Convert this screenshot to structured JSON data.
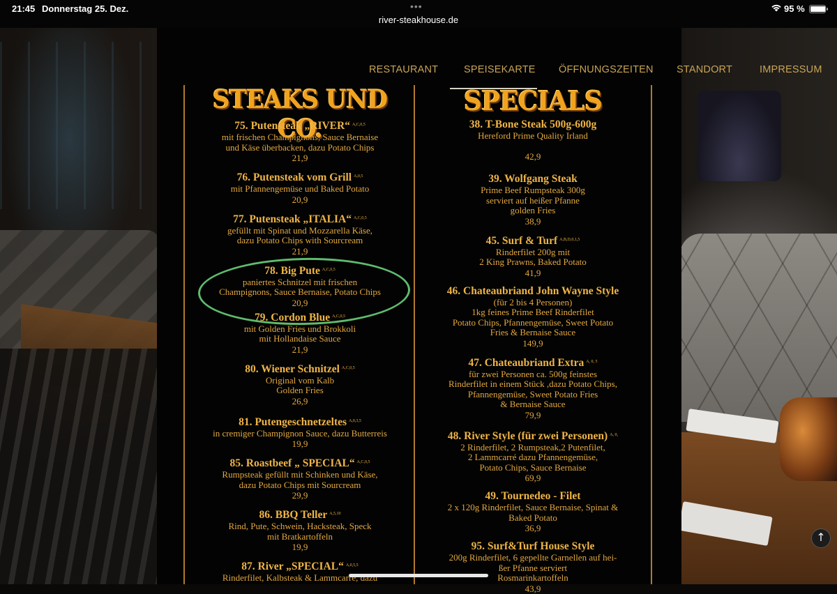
{
  "status_bar": {
    "time": "21:45",
    "date": "Donnerstag 25. Dez.",
    "url": "river-steakhouse.de",
    "battery_percent": "95 %",
    "battery_level": 0.95,
    "multitask_dots": "•••"
  },
  "nav": {
    "items": [
      {
        "label": "RESTAURANT",
        "active": false
      },
      {
        "label": "SPEISEKARTE",
        "active": true
      },
      {
        "label": "ÖFFNUNGSZEITEN",
        "active": false
      },
      {
        "label": "STANDORT",
        "active": false
      },
      {
        "label": "IMPRESSUM",
        "active": false
      }
    ]
  },
  "menu": {
    "left": {
      "heading": "Steaks und Co.",
      "entries": [
        {
          "title": "75. Putensteak „RIVER“",
          "codes": "A,C,0,5",
          "lines": [
            "mit frischen Champignons, Sauce Bernaise",
            "und Käse überbacken, dazu Potato Chips"
          ],
          "price": "21,9"
        },
        {
          "title": "76. Putensteak vom Grill",
          "codes": "A,0,5",
          "lines": [
            "mit Pfannengemüse und Baked Potato"
          ],
          "price": "20,9"
        },
        {
          "title": "77. Putensteak „ITALIA“",
          "codes": "A,C,0,5",
          "lines": [
            "gefüllt mit Spinat und Mozzarella Käse,",
            "dazu Potato Chips with Sourcream"
          ],
          "price": "21,9"
        },
        {
          "title": "78. Big Pute",
          "codes": "A,C,0,5",
          "lines": [
            "paniertes Schnitzel mit frischen",
            "Champignons, Sauce Bernaise, Potato Chips"
          ],
          "price": "20,9"
        },
        {
          "title": "79. Cordon Blue",
          "codes": "A,C,0,5",
          "lines": [
            "mit Golden Fries und Brokkoli",
            "mit Hollandaise Sauce"
          ],
          "price": "21,9"
        },
        {
          "title": "80. Wiener Schnitzel",
          "codes": "A,C,0,5",
          "lines": [
            "Original vom Kalb",
            "Golden Fries"
          ],
          "price": "26,9"
        },
        {
          "title": "81. Putengeschnetzeltes",
          "codes": "A,0,3,5",
          "lines": [
            "in cremiger Champignon Sauce, dazu Butterreis"
          ],
          "price": "19,9"
        },
        {
          "title": "85. Roastbeef „ SPECIAL“",
          "codes": "A,C,0,5",
          "lines": [
            "Rumpsteak gefüllt mit Schinken und Käse,",
            "dazu Potato Chips mit Sourcream"
          ],
          "price": "29,9"
        },
        {
          "title": "86. BBQ Teller",
          "codes": "A,5,10",
          "lines": [
            "Rind, Pute, Schwein, Hacksteak, Speck",
            "mit Bratkartoffeln"
          ],
          "price": "19,9"
        },
        {
          "title": "87. River „SPECIAL“",
          "codes": "A,0,5,5",
          "lines": [
            "Rinderfilet, Kalbsteak & Lammcarré, dazu"
          ],
          "price": ""
        }
      ]
    },
    "right": {
      "heading": "Specials",
      "entries": [
        {
          "title": "38. T-Bone Steak 500g-600g",
          "codes": "",
          "lines": [
            "Hereford Prime Quality Irland",
            ""
          ],
          "price": "42,9"
        },
        {
          "title": "39. Wolfgang Steak",
          "codes": "",
          "lines": [
            "Prime Beef Rumpsteak 300g",
            "serviert auf heißer Pfanne",
            "golden Fries"
          ],
          "price": "38,9"
        },
        {
          "title": "45. Surf & Turf",
          "codes": "A,B,D,0,1,5",
          "lines": [
            "Rinderfilet 200g mit",
            "2 King Prawns, Baked Potato"
          ],
          "price": "41,9"
        },
        {
          "title": "46. Chateaubriand John Wayne Style",
          "codes": "",
          "lines": [
            "(für 2 bis 4 Personen)",
            "1kg feines Prime Beef Rinderfilet",
            "Potato Chips, Pfannengemüse, Sweet Potato",
            "Fries & Bernaise Sauce"
          ],
          "price": "149,9"
        },
        {
          "title": "47. Chateaubriand Extra",
          "codes": "A, 0, 5",
          "lines": [
            "für zwei Personen ca. 500g feinstes",
            "Rinderfilet in einem Stück ,dazu Potato Chips,",
            "Pfannengemüse, Sweet Potato Fries",
            "& Bernaise Sauce"
          ],
          "price": "79,9"
        },
        {
          "title": "48. River Style  (für zwei Personen)",
          "codes": "A, 0,",
          "lines": [
            "2 Rinderfilet, 2 Rumpsteak,2 Putenfilet,",
            "2 Lammcarré dazu Pfannengemüse,",
            "Potato Chips, Sauce Bernaise"
          ],
          "price": "69,9"
        },
        {
          "title": "49. Tournedeo - Filet",
          "codes": "",
          "lines": [
            "2 x 120g Rinderfilet, Sauce Bernaise, Spinat &",
            "Baked Potato"
          ],
          "price": "36,9"
        },
        {
          "title": "95. Surf&Turf House Style",
          "codes": "",
          "lines": [
            "200g Rinderfilet, 6 gepellte Garnellen auf hei-",
            "ßer Pfanne serviert",
            "Rosmarinkartoffeln"
          ],
          "price": "43,9"
        }
      ]
    }
  },
  "scroll_top_icon": "↑",
  "colors": {
    "gold": "#efb447",
    "heading_orange": "#f0a31e",
    "highlight_green": "#5fbb6e",
    "nav_text": "#c9a455"
  }
}
